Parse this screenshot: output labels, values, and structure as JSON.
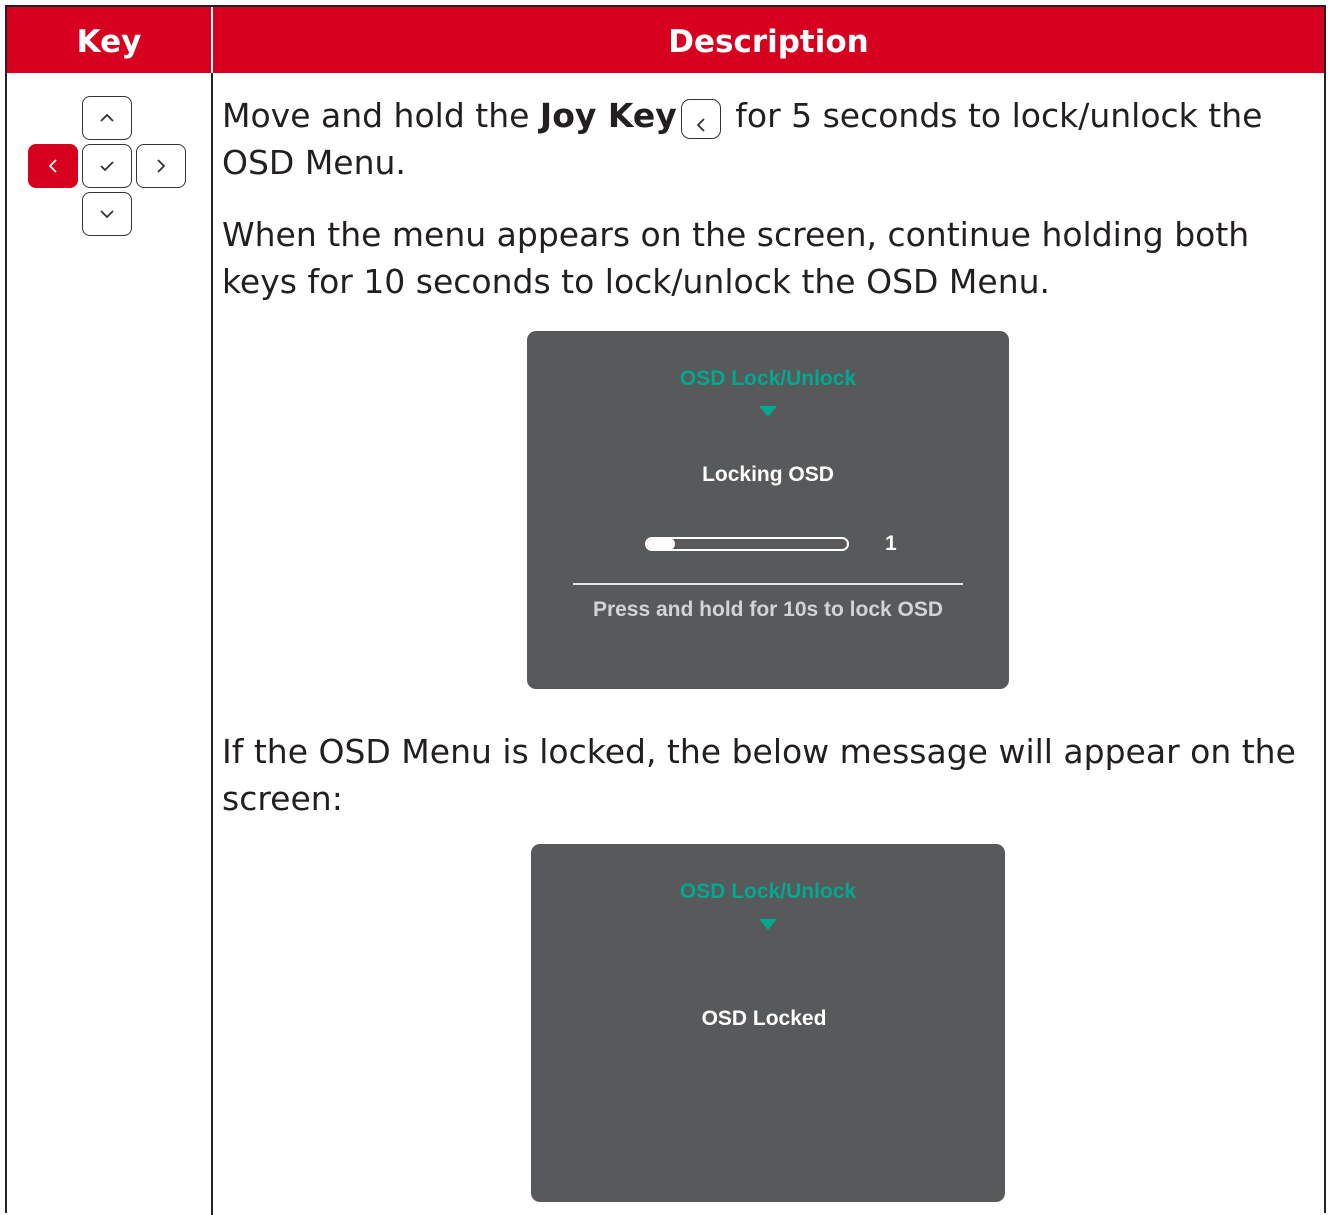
{
  "header": {
    "key": "Key",
    "description": "Description"
  },
  "joy_key": {
    "buttons": [
      "up-icon",
      "left-icon",
      "check-icon",
      "right-icon",
      "down-icon"
    ],
    "highlighted": "left-icon",
    "highlight_color": "#d7001f"
  },
  "description": {
    "p1_prefix": "Move and hold the ",
    "p1_bold": "Joy Key",
    "p1_suffix": " for 5 seconds to lock/unlock the",
    "p1_line2": "OSD Menu.",
    "p2_line1": "When the menu appears on the screen, continue holding both",
    "p2_line2": "keys for 10 seconds to lock/unlock the OSD Menu.",
    "p3_line1": "If the OSD Menu is locked, the below message will appear on the",
    "p3_line2": "screen:"
  },
  "osd1": {
    "title": "OSD Lock/Unlock",
    "label": "Locking OSD",
    "progress_value": "1",
    "progress_fraction": 0.1,
    "hint": "Press and hold for 10s to lock OSD"
  },
  "osd2": {
    "title": "OSD Lock/Unlock",
    "label": "OSD Locked"
  },
  "colors": {
    "brand_red": "#d7001f",
    "osd_bg": "#58595b",
    "osd_accent": "#00a98f"
  }
}
